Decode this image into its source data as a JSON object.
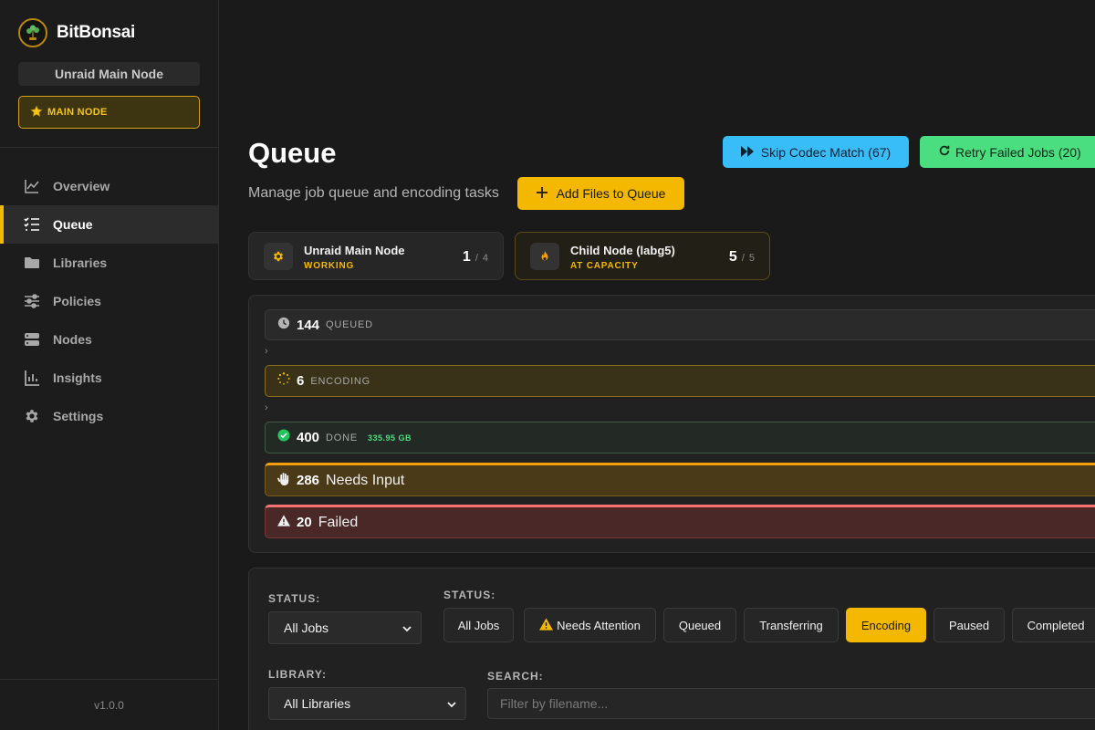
{
  "app": {
    "name": "BitBonsai",
    "version": "v1.0.0"
  },
  "sidebar": {
    "node_name": "Unraid Main Node",
    "node_badge": "MAIN NODE",
    "items": [
      {
        "label": "Overview",
        "icon": "chart-line-icon"
      },
      {
        "label": "Queue",
        "icon": "list-check-icon",
        "active": true
      },
      {
        "label": "Libraries",
        "icon": "folder-icon"
      },
      {
        "label": "Policies",
        "icon": "sliders-icon"
      },
      {
        "label": "Nodes",
        "icon": "server-icon"
      },
      {
        "label": "Insights",
        "icon": "bar-chart-icon"
      },
      {
        "label": "Settings",
        "icon": "gear-icon"
      }
    ]
  },
  "header": {
    "title": "Queue",
    "subtitle": "Manage job queue and encoding tasks",
    "add_files_label": "Add Files to Queue",
    "skip_codec_label": "Skip Codec Match (67)",
    "retry_failed_label": "Retry Failed Jobs (20)"
  },
  "nodes": [
    {
      "name": "Unraid Main Node",
      "status": "WORKING",
      "active": "1",
      "capacity": "4",
      "icon": "gear-icon"
    },
    {
      "name": "Child Node (labg5)",
      "status": "AT CAPACITY",
      "active": "5",
      "capacity": "5",
      "icon": "fire-icon"
    }
  ],
  "statuses": {
    "queued": {
      "count": "144",
      "label": "QUEUED"
    },
    "encoding": {
      "count": "6",
      "label": "ENCODING"
    },
    "done": {
      "count": "400",
      "label": "DONE",
      "size": "335.95 GB"
    },
    "needs_input": {
      "count": "286",
      "label": "Needs Input"
    },
    "failed": {
      "count": "20",
      "label": "Failed"
    }
  },
  "filters": {
    "status_label": "STATUS:",
    "status_selected": "All Jobs",
    "chips_label": "STATUS:",
    "chips": [
      {
        "label": "All Jobs"
      },
      {
        "label": "Needs Attention"
      },
      {
        "label": "Queued"
      },
      {
        "label": "Transferring"
      },
      {
        "label": "Encoding",
        "active": true
      },
      {
        "label": "Paused"
      },
      {
        "label": "Completed"
      }
    ],
    "library_label": "LIBRARY:",
    "library_selected": "All Libraries",
    "search_label": "SEARCH:",
    "search_placeholder": "Filter by filename...",
    "search_value": ""
  },
  "colors": {
    "accent": "#f5b800",
    "info": "#38bdf8",
    "success": "#4ade80",
    "danger": "#f87171",
    "background": "#1a1a1a"
  }
}
